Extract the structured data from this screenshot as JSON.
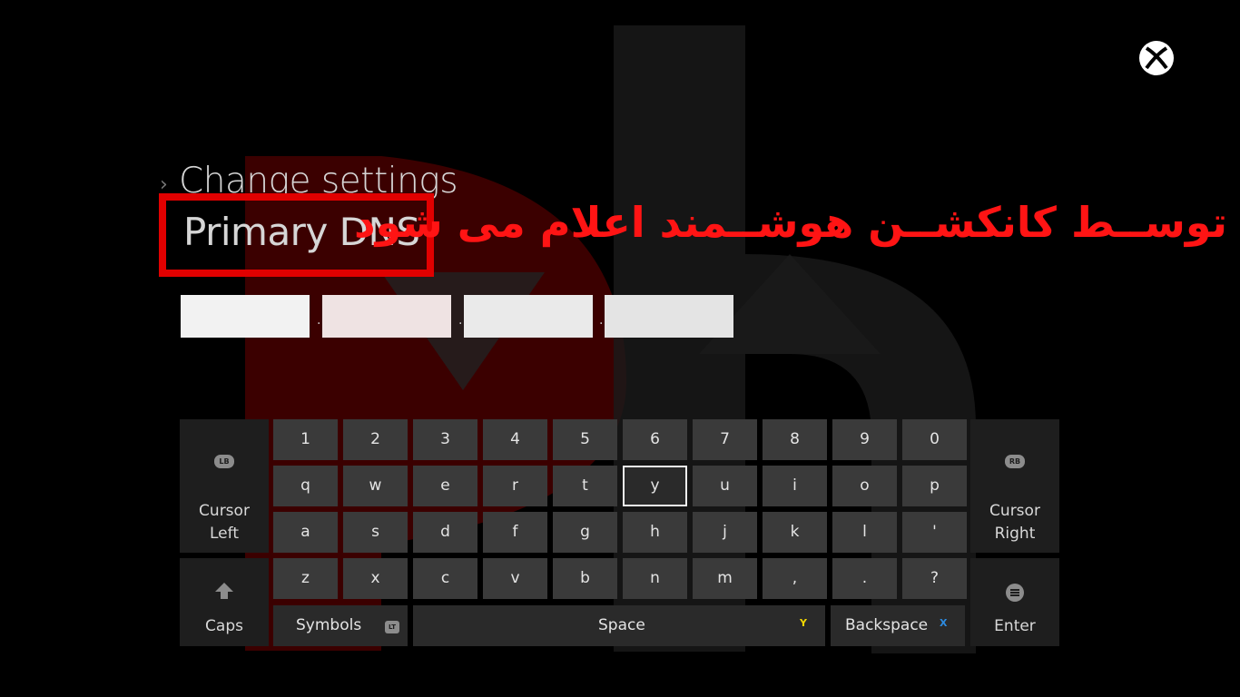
{
  "header": {
    "breadcrumb": "Change settings",
    "title": "Primary DNS"
  },
  "overlay": {
    "text": "توســط کانکشــن هوشــمند اعلام می شود",
    "color": "#ff1414"
  },
  "dns_fields": [
    {
      "value": ""
    },
    {
      "value": ""
    },
    {
      "value": ""
    },
    {
      "value": ""
    }
  ],
  "dns_separator": ".",
  "keyboard": {
    "rows": [
      [
        "1",
        "2",
        "3",
        "4",
        "5",
        "6",
        "7",
        "8",
        "9",
        "0"
      ],
      [
        "q",
        "w",
        "e",
        "r",
        "t",
        "y",
        "u",
        "i",
        "o",
        "p"
      ],
      [
        "a",
        "s",
        "d",
        "f",
        "g",
        "h",
        "j",
        "k",
        "l",
        "'"
      ],
      [
        "z",
        "x",
        "c",
        "v",
        "b",
        "n",
        "m",
        ",",
        ".",
        "?"
      ]
    ],
    "selected_key": "y",
    "cursor_left": {
      "line1": "Cursor",
      "line2": "Left",
      "badge": "LB"
    },
    "cursor_right": {
      "line1": "Cursor",
      "line2": "Right",
      "badge": "RB"
    },
    "caps": "Caps",
    "symbols": "Symbols",
    "symbols_badge": "LT",
    "space": "Space",
    "space_button": "Y",
    "backspace": "Backspace",
    "backspace_button": "X",
    "enter": "Enter"
  },
  "colors": {
    "accent_frame": "#e10000",
    "xbox_y": "#f2d600",
    "xbox_x": "#2d8be0"
  },
  "icons": {
    "xbox": "xbox-logo-icon",
    "caps": "caps-arrow-icon",
    "enter": "menu-icon"
  }
}
